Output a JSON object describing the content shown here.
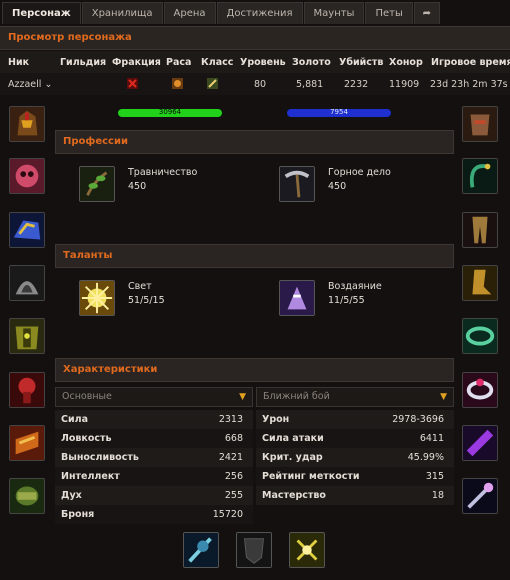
{
  "tabs": [
    "Персонаж",
    "Хранилища",
    "Арена",
    "Достижения",
    "Маунты",
    "Петы"
  ],
  "panel_title": "Просмотр персонажа",
  "table": {
    "headers": [
      "Ник",
      "Гильдия",
      "Фракция",
      "Раса",
      "Класс",
      "Уровень",
      "Золото",
      "Убийств",
      "Хонор",
      "Игровое время"
    ],
    "row": {
      "name": "Azzaell",
      "guild": "",
      "level": "80",
      "gold": "5,881",
      "kills": "2232",
      "honor": "11909",
      "playtime": "23d 23h 2m 37s"
    }
  },
  "health_bar": {
    "value": "30964",
    "color": "#22d11a"
  },
  "mana_bar": {
    "value": "7954",
    "color": "#1f2fd0"
  },
  "professions": {
    "title": "Профессии",
    "items": [
      {
        "name": "Травничество",
        "value": "450",
        "icon": "herbalism-icon"
      },
      {
        "name": "Горное дело",
        "value": "450",
        "icon": "mining-icon"
      }
    ]
  },
  "talents": {
    "title": "Таланты",
    "items": [
      {
        "name": "Свет",
        "value": "51/5/15",
        "icon": "holy-light-icon"
      },
      {
        "name": "Воздаяние",
        "value": "11/5/55",
        "icon": "retribution-icon"
      }
    ]
  },
  "characteristics": {
    "title": "Характеристики",
    "left_dropdown": "Основные",
    "right_dropdown": "Ближний бой",
    "left_stats": [
      {
        "name": "Сила",
        "value": "2313"
      },
      {
        "name": "Ловкость",
        "value": "668"
      },
      {
        "name": "Выносливость",
        "value": "2421"
      },
      {
        "name": "Интеллект",
        "value": "256"
      },
      {
        "name": "Дух",
        "value": "255"
      },
      {
        "name": "Броня",
        "value": "15720"
      }
    ],
    "right_stats": [
      {
        "name": "Урон",
        "value": "2978-3696"
      },
      {
        "name": "Сила атаки",
        "value": "6411"
      },
      {
        "name": "Крит. удар",
        "value": "45.99%"
      },
      {
        "name": "Рейтинг меткости",
        "value": "315"
      },
      {
        "name": "Мастерство",
        "value": "18"
      }
    ]
  },
  "colors": {
    "accent": "#e06a1e",
    "gold_chevron": "#e0a020"
  }
}
